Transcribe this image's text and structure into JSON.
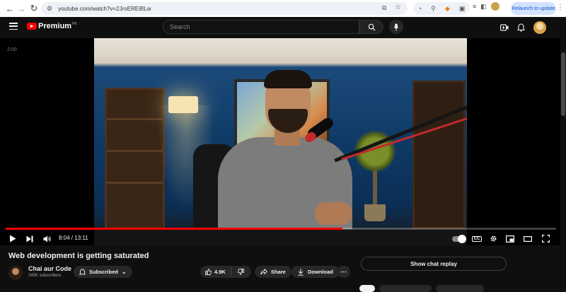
{
  "browser": {
    "url": "youtube.com/watch?v=2JroEREiBLw",
    "relaunch_label": "Relaunch to update"
  },
  "header": {
    "logo_text": "Premium",
    "logo_region": "PK",
    "search_placeholder": "Search"
  },
  "player": {
    "side_time": "2:00",
    "current_time": "8:04",
    "duration": "13:11",
    "time_display": "8:04 / 13:11",
    "progress_fraction": 0.612,
    "cc_label": "CC"
  },
  "video": {
    "title": "Web development is getting saturated",
    "channel_name": "Chai aur Code",
    "subscribers": "245K subscribers",
    "subscribe_label": "Subscribed",
    "like_count": "4.9K",
    "share_label": "Share",
    "download_label": "Download"
  },
  "chat": {
    "replay_label": "Show chat replay"
  },
  "colors": {
    "brand_red": "#ff0000",
    "background": "#0f0f0f",
    "pill": "#272727"
  }
}
